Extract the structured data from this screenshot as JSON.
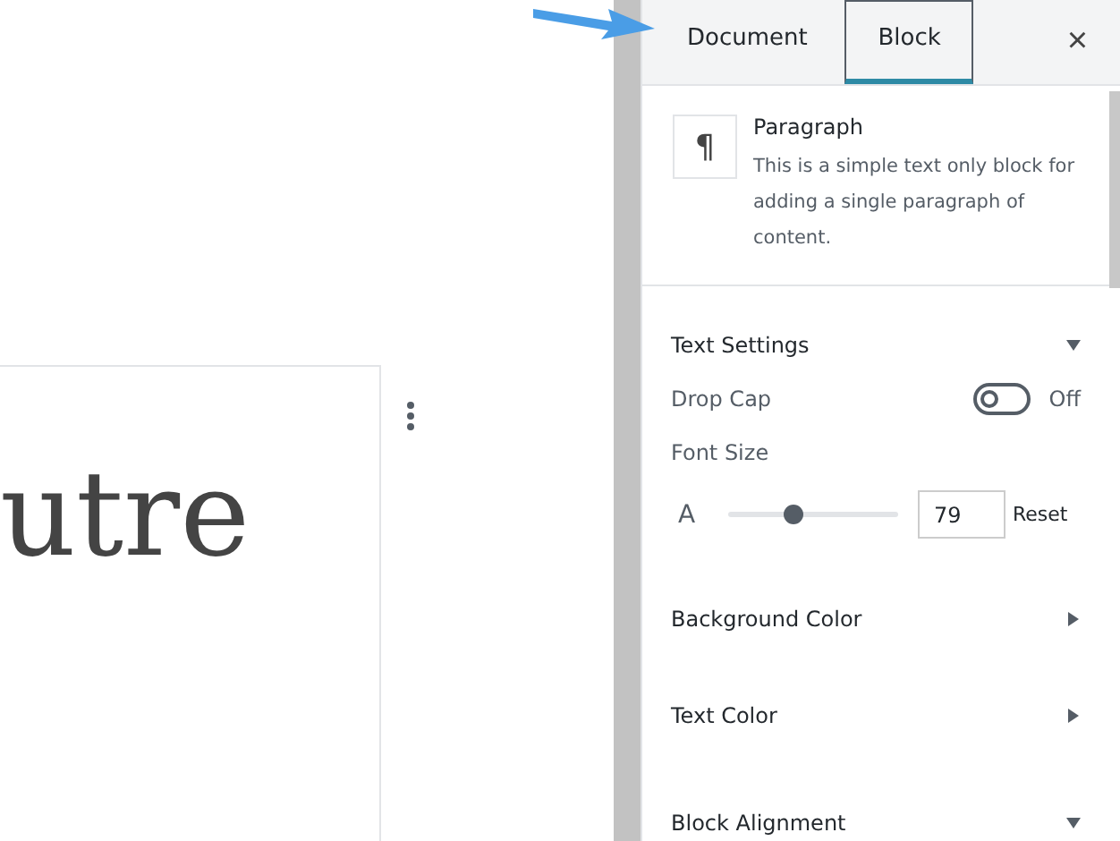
{
  "editor": {
    "text": "utre"
  },
  "sidebar": {
    "tabs": [
      {
        "label": "Document",
        "selected": false
      },
      {
        "label": "Block",
        "selected": true
      }
    ],
    "close": "×",
    "block": {
      "icon": "¶",
      "title": "Paragraph",
      "description": "This is a simple text only block for adding a single paragraph of content."
    },
    "panels": [
      {
        "title": "Text Settings",
        "expanded": true,
        "drop_cap": {
          "label": "Drop Cap",
          "on": false,
          "state": "Off"
        },
        "font_size": {
          "label": "Font Size",
          "icon": "A",
          "level": 0.38,
          "value": "79",
          "reset": "Reset"
        }
      },
      {
        "title": "Background Color",
        "expanded": false
      },
      {
        "title": "Text Color",
        "expanded": false
      },
      {
        "title": "Block Alignment",
        "expanded": true
      }
    ]
  }
}
